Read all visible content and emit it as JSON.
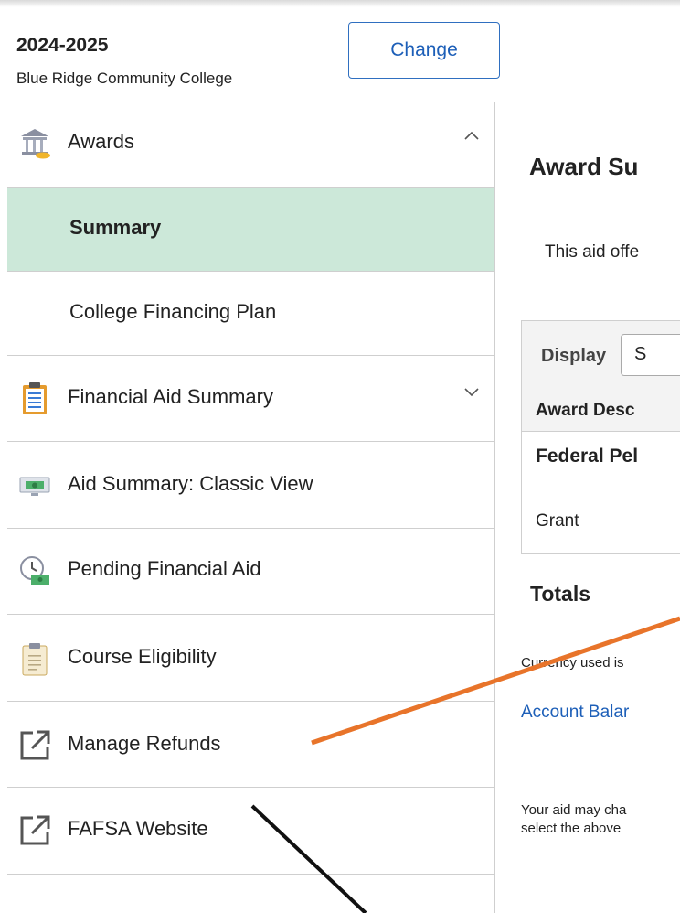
{
  "header": {
    "aid_year": "2024-2025",
    "institution": "Blue Ridge Community College",
    "change_label": "Change"
  },
  "sidebar": {
    "items": [
      {
        "label": "Awards",
        "icon": "awards-building-icon",
        "expanded": true
      },
      {
        "label": "Summary",
        "selected": true
      },
      {
        "label": "College Financing Plan"
      },
      {
        "label": "Financial Aid Summary",
        "icon": "clipboard-list-icon",
        "expanded": false
      },
      {
        "label": "Aid Summary: Classic View",
        "icon": "money-screen-icon"
      },
      {
        "label": "Pending Financial Aid",
        "icon": "clock-money-icon"
      },
      {
        "label": "Course Eligibility",
        "icon": "clipboard-icon"
      },
      {
        "label": "Manage Refunds",
        "icon": "external-link-icon"
      },
      {
        "label": "FAFSA Website",
        "icon": "external-link-icon"
      }
    ]
  },
  "main": {
    "title": "Award Su",
    "intro": "This aid offe",
    "table": {
      "display_label": "Display",
      "select_value": "S",
      "header": "Award Desc",
      "row_title": "Federal Pel",
      "row_type": "Grant"
    },
    "totals": "Totals",
    "currency": "Currency used is",
    "account_link": "Account Balar",
    "note_line1": "Your aid may cha",
    "note_line2": "select the above"
  },
  "colors": {
    "selected_bg": "#cce8d9",
    "link": "#1d5fb8",
    "annotation_orange": "#e8742a",
    "annotation_black": "#111111"
  }
}
